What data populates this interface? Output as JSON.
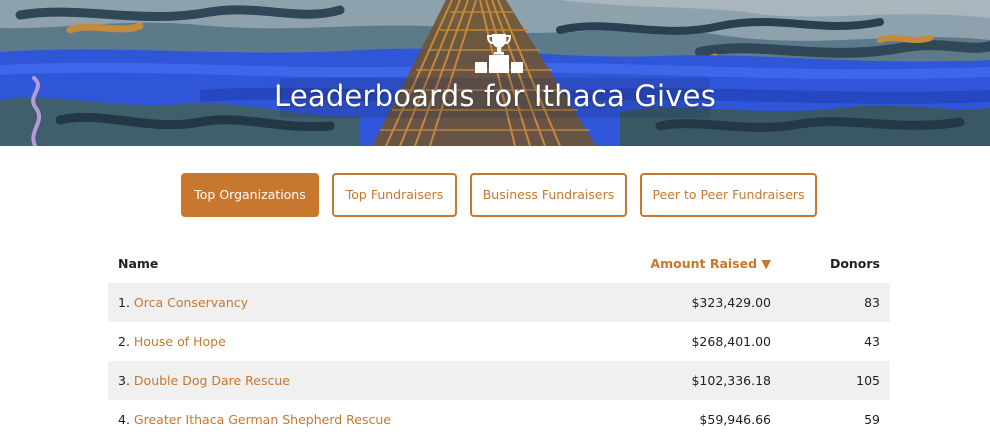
{
  "banner": {
    "title": "Leaderboards for Ithaca Gives",
    "icon": "podium-trophy-icon"
  },
  "tabs": [
    {
      "label": "Top Organizations",
      "active": true
    },
    {
      "label": "Top Fundraisers",
      "active": false
    },
    {
      "label": "Business Fundraisers",
      "active": false
    },
    {
      "label": "Peer to Peer Fundraisers",
      "active": false
    }
  ],
  "table": {
    "headers": {
      "name": "Name",
      "amount": "Amount Raised ▼",
      "donors": "Donors"
    },
    "rows": [
      {
        "rank": "1.",
        "name": "Orca Conservancy",
        "amount": "$323,429.00",
        "donors": "83"
      },
      {
        "rank": "2.",
        "name": "House of Hope",
        "amount": "$268,401.00",
        "donors": "43"
      },
      {
        "rank": "3.",
        "name": "Double Dog Dare Rescue",
        "amount": "$102,336.18",
        "donors": "105"
      },
      {
        "rank": "4.",
        "name": "Greater Ithaca German Shepherd Rescue",
        "amount": "$59,946.66",
        "donors": "59"
      }
    ]
  },
  "colors": {
    "accent": "#c8772e",
    "row_shade": "#f0f0f0",
    "banner_water": "#2f55d9",
    "banner_sky": "#7f98a8"
  }
}
